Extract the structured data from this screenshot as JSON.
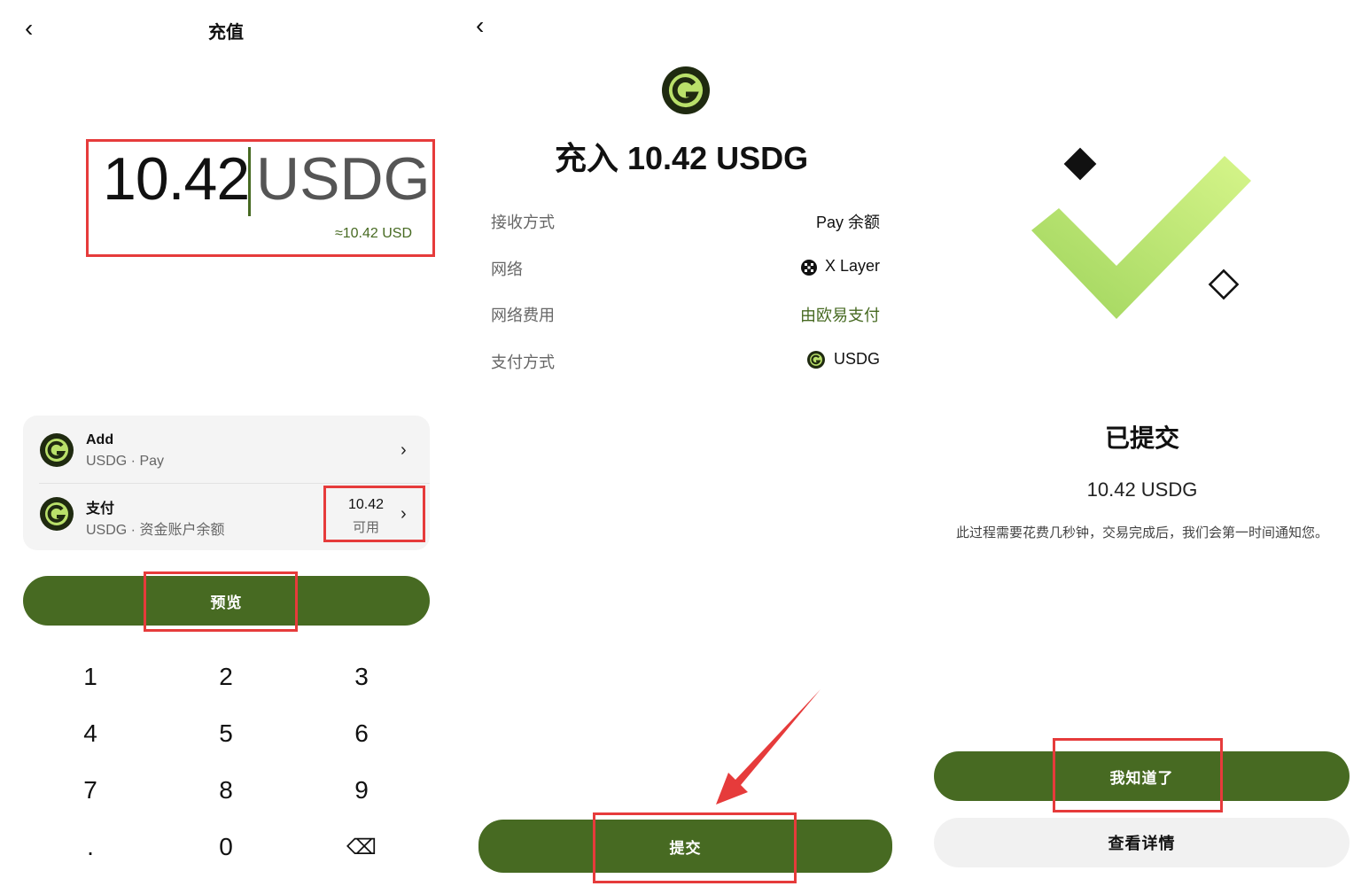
{
  "panel1": {
    "header": {
      "back_icon": "‹",
      "title": "充值"
    },
    "amount": {
      "value": "10.42",
      "unit": "USDG",
      "approx": "≈10.42 USD"
    },
    "add_row": {
      "title": "Add",
      "subtitle": "USDG · Pay",
      "chevron": "›"
    },
    "pay_row": {
      "title": "支付",
      "subtitle": "USDG · 资金账户余额",
      "balance": "10.42",
      "balance_label": "可用",
      "chevron": "›"
    },
    "preview_button": "预览",
    "keypad": [
      "1",
      "2",
      "3",
      "4",
      "5",
      "6",
      "7",
      "8",
      "9",
      ".",
      "0",
      "⌫"
    ]
  },
  "panel2": {
    "back_icon": "‹",
    "title": "充入 10.42 USDG",
    "rows": [
      {
        "label": "接收方式",
        "value": "Pay 余额"
      },
      {
        "label": "网络",
        "value": "X Layer"
      },
      {
        "label": "网络费用",
        "value": "由欧易支付"
      },
      {
        "label": "支付方式",
        "value": "USDG"
      }
    ],
    "submit_button": "提交"
  },
  "panel3": {
    "title": "已提交",
    "amount": "10.42 USDG",
    "note": "此过程需要花费几秒钟，交易完成后，我们会第一时间通知您。",
    "got_it_button": "我知道了",
    "details_button": "查看详情"
  },
  "colors": {
    "brand_green": "#476a22",
    "highlight_red": "#e63b3b",
    "coin_lime": "#b9e06a"
  }
}
